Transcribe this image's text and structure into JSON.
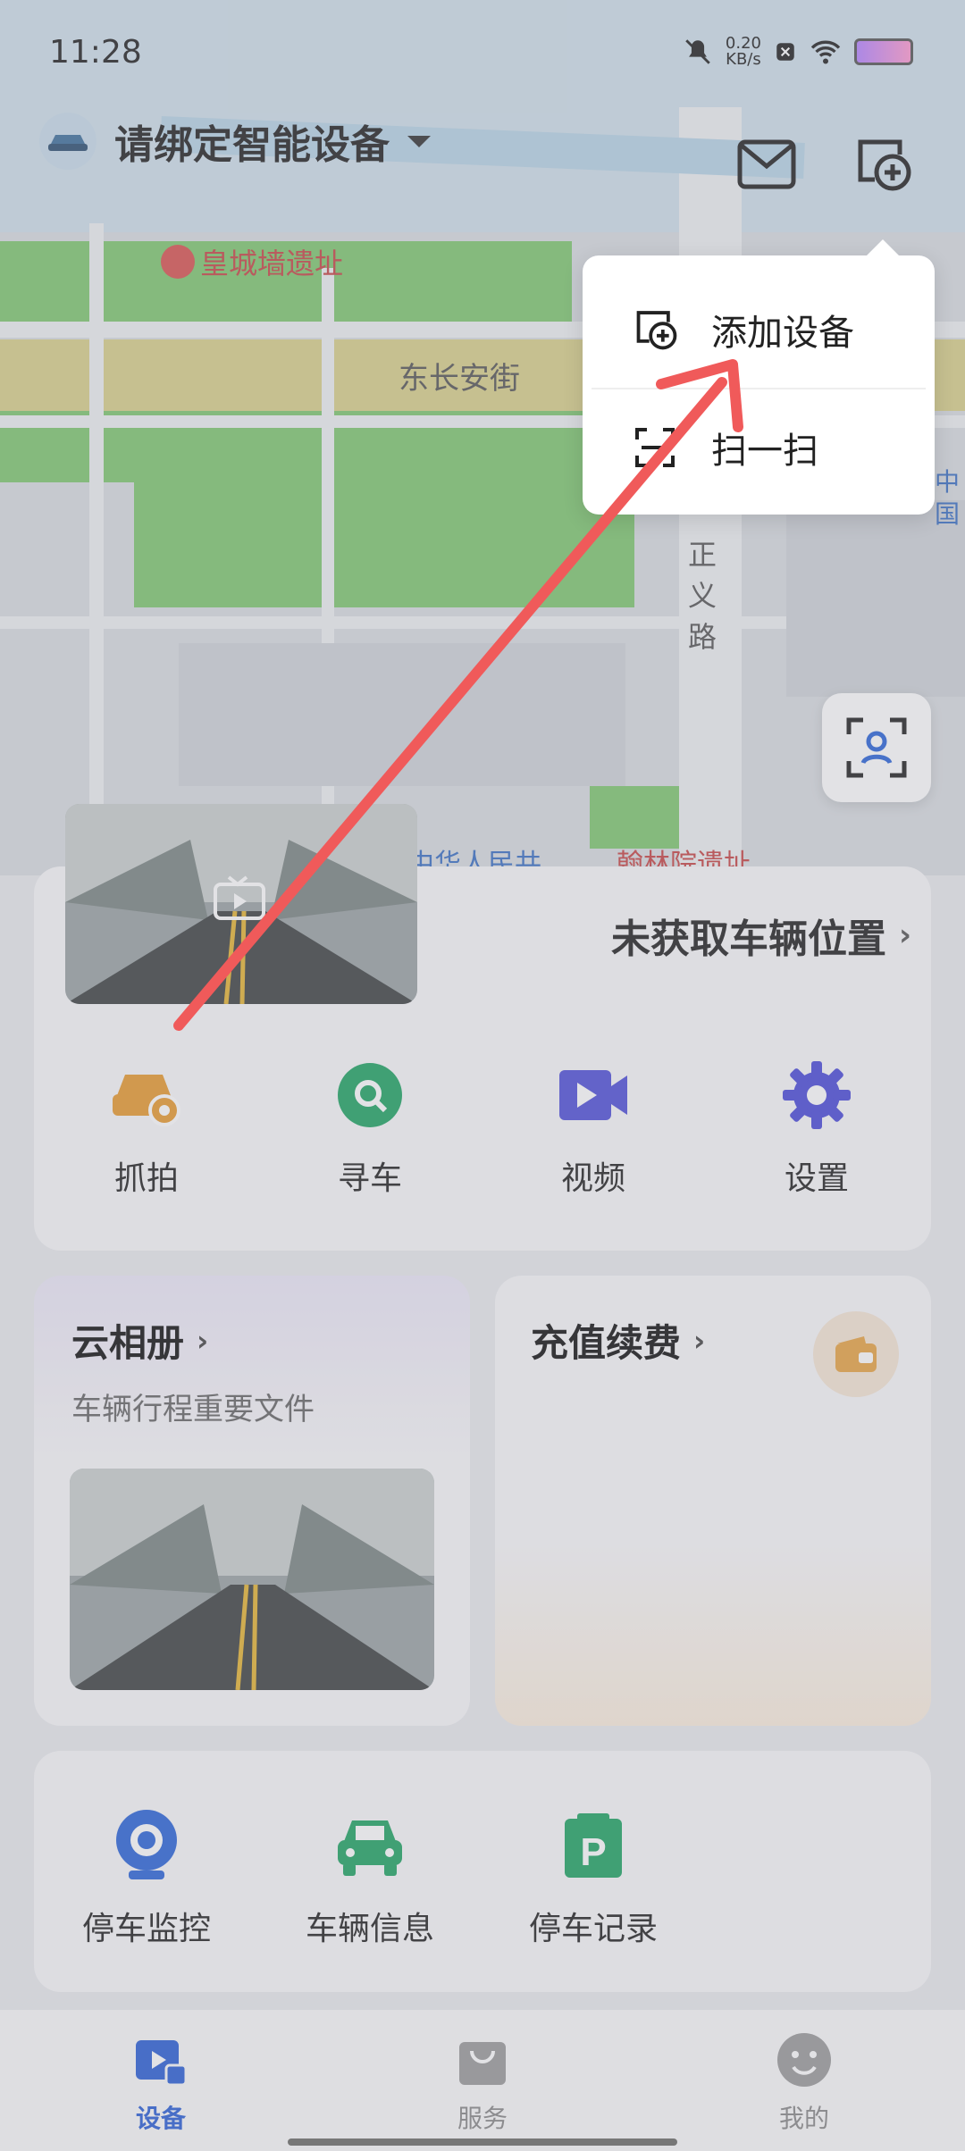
{
  "status_bar": {
    "time": "11:28",
    "speed_value": "0.20",
    "speed_unit": "KB/s"
  },
  "header": {
    "device_title": "请绑定智能设备"
  },
  "map": {
    "poi_1": "皇城墙遗址",
    "street_1": "东长安街",
    "street_2_chars": [
      "正",
      "义",
      "路"
    ],
    "edge_label_chars": [
      "中",
      "国"
    ],
    "bottom_label_1": "中华人民共",
    "bottom_label_2": "翰林院遗址"
  },
  "popup_menu": {
    "items": [
      {
        "label": "添加设备",
        "icon": "add-device-icon"
      },
      {
        "label": "扫一扫",
        "icon": "scan-icon"
      }
    ]
  },
  "vehicle_card": {
    "location_text": "未获取车辆位置",
    "quick_actions": [
      {
        "label": "抓拍",
        "icon": "car-camera-icon",
        "color": "#e89a2e"
      },
      {
        "label": "寻车",
        "icon": "search-car-icon",
        "color": "#1fa463"
      },
      {
        "label": "视频",
        "icon": "video-icon",
        "color": "#4f4fd8"
      },
      {
        "label": "设置",
        "icon": "gear-icon",
        "color": "#4a4ad8"
      }
    ]
  },
  "album_card": {
    "title": "云相册",
    "subtitle": "车辆行程重要文件"
  },
  "recharge_card": {
    "title": "充值续费"
  },
  "parking_card": {
    "items": [
      {
        "label": "停车监控",
        "icon": "parking-monitor-icon",
        "color": "#2a64d8"
      },
      {
        "label": "车辆信息",
        "icon": "car-info-icon",
        "color": "#1fa463"
      },
      {
        "label": "停车记录",
        "icon": "parking-record-icon",
        "color": "#1fa463"
      }
    ]
  },
  "bottom_nav": {
    "items": [
      {
        "label": "设备",
        "active": true,
        "color": "#2a5fd6"
      },
      {
        "label": "服务",
        "active": false,
        "color": "#888888"
      },
      {
        "label": "我的",
        "active": false,
        "color": "#888888"
      }
    ]
  }
}
